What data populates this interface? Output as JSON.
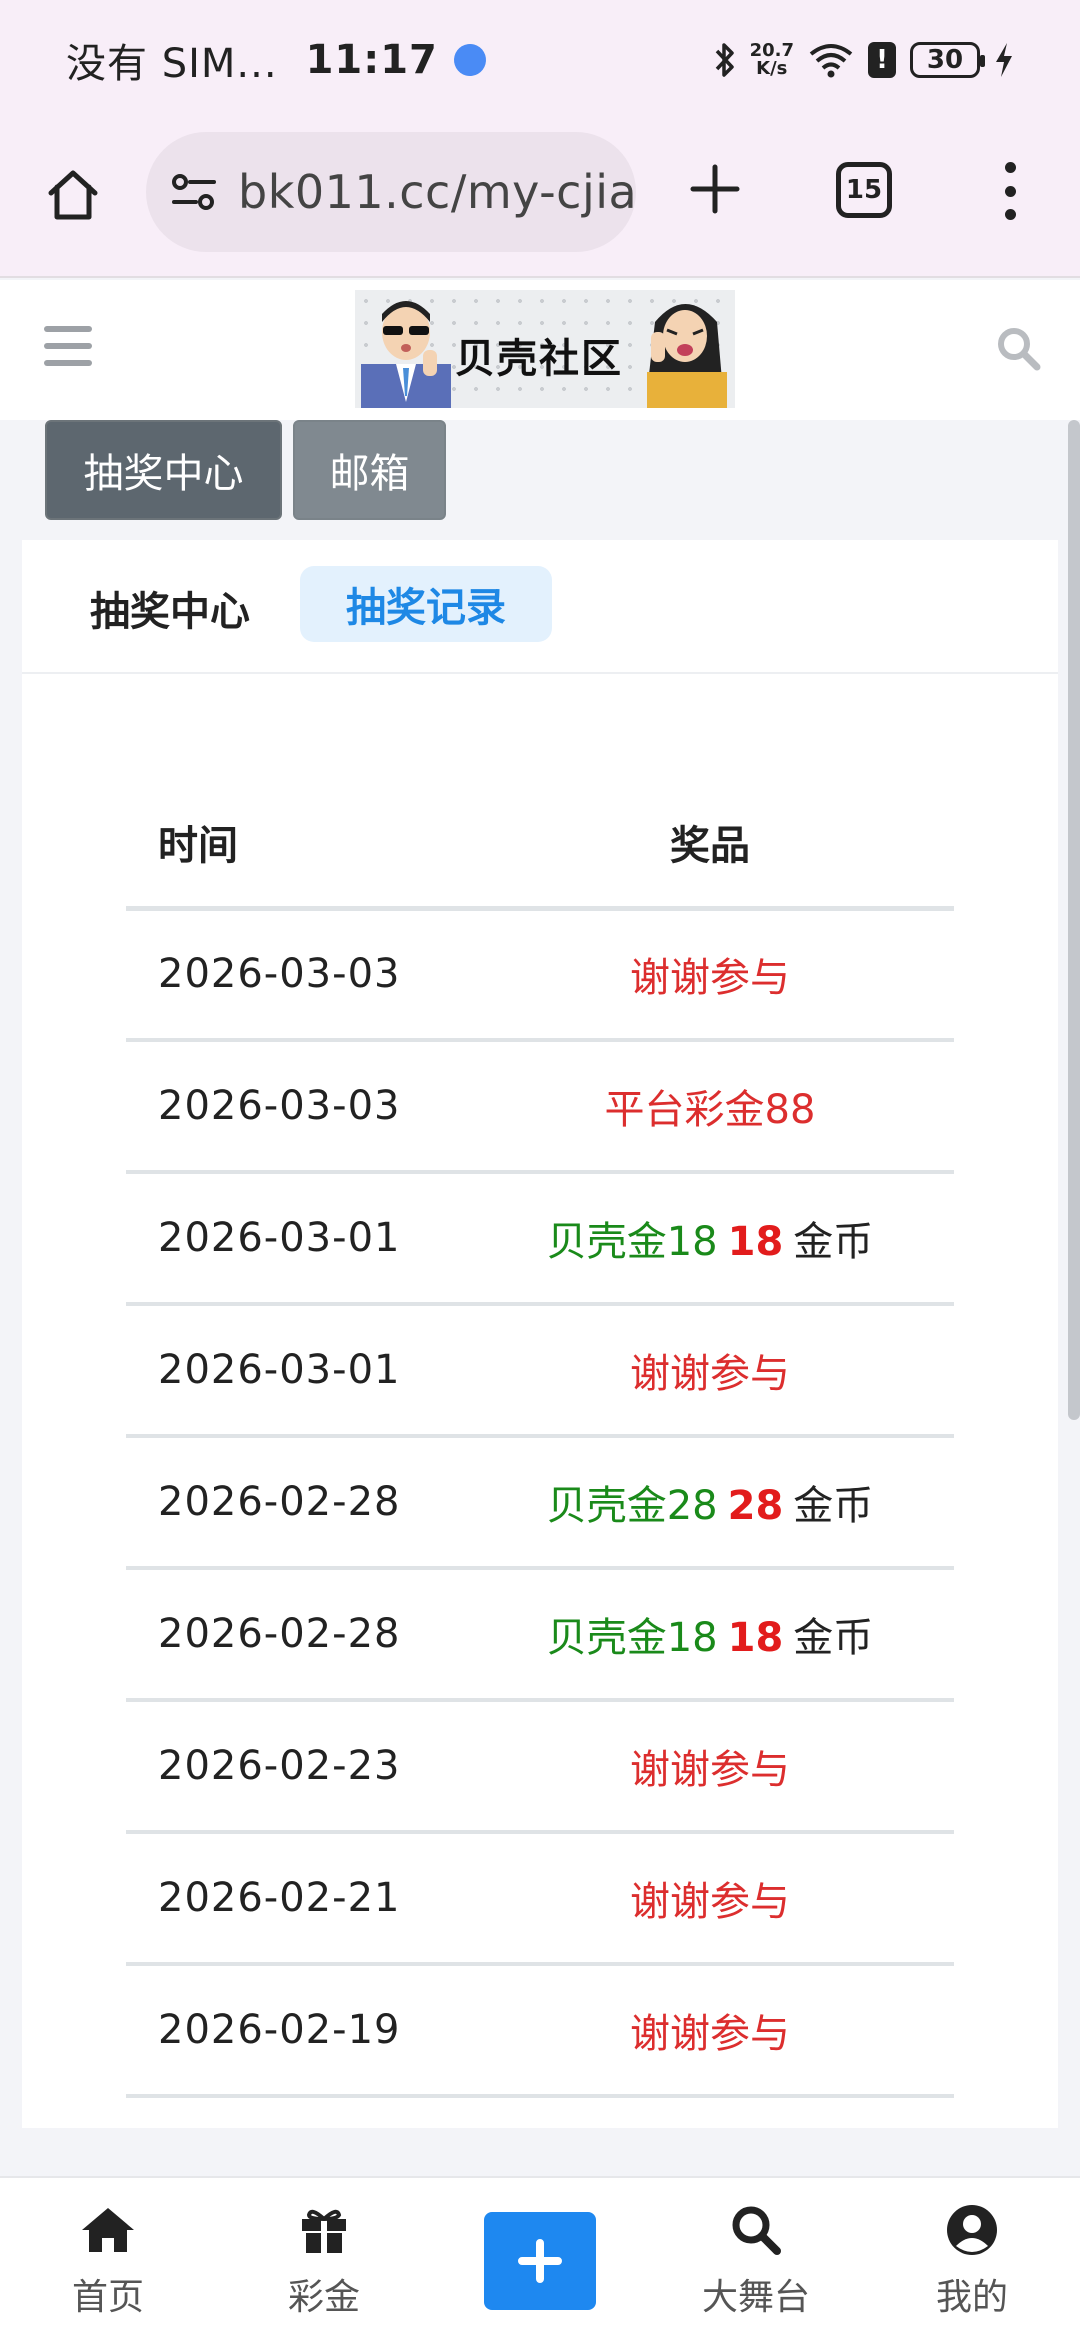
{
  "status_bar": {
    "carrier": "没有 SIM...",
    "time": "11:17",
    "net_speed_value": "20.7",
    "net_speed_unit": "K/s",
    "battery": "30"
  },
  "browser": {
    "url": "bk011.cc/my-cjia",
    "tab_count": "15"
  },
  "header": {
    "logo_text": "贝壳社区"
  },
  "nav_buttons": {
    "lottery_center": "抽奖中心",
    "mailbox": "邮箱"
  },
  "card": {
    "tab_center": "抽奖中心",
    "tab_records": "抽奖记录",
    "table": {
      "col_time": "时间",
      "col_prize": "奖品",
      "rows": [
        {
          "time": "2026-03-03",
          "prize": "谢谢参与",
          "coin": "",
          "unit": ""
        },
        {
          "time": "2026-03-03",
          "prize": "平台彩金88",
          "coin": "",
          "unit": ""
        },
        {
          "time": "2026-03-01",
          "prize": "贝壳金18",
          "coin": "18",
          "unit": "金币"
        },
        {
          "time": "2026-03-01",
          "prize": "谢谢参与",
          "coin": "",
          "unit": ""
        },
        {
          "time": "2026-02-28",
          "prize": "贝壳金28",
          "coin": "28",
          "unit": "金币"
        },
        {
          "time": "2026-02-28",
          "prize": "贝壳金18",
          "coin": "18",
          "unit": "金币"
        },
        {
          "time": "2026-02-23",
          "prize": "谢谢参与",
          "coin": "",
          "unit": ""
        },
        {
          "time": "2026-02-21",
          "prize": "谢谢参与",
          "coin": "",
          "unit": ""
        },
        {
          "time": "2026-02-19",
          "prize": "谢谢参与",
          "coin": "",
          "unit": ""
        }
      ]
    }
  },
  "bottom_nav": {
    "home": "首页",
    "bonus": "彩金",
    "stage": "大舞台",
    "mine": "我的"
  },
  "colors": {
    "accent_blue": "#1e88f0",
    "prize_red": "#dc2e2e",
    "prize_green": "#1a8a1a"
  }
}
